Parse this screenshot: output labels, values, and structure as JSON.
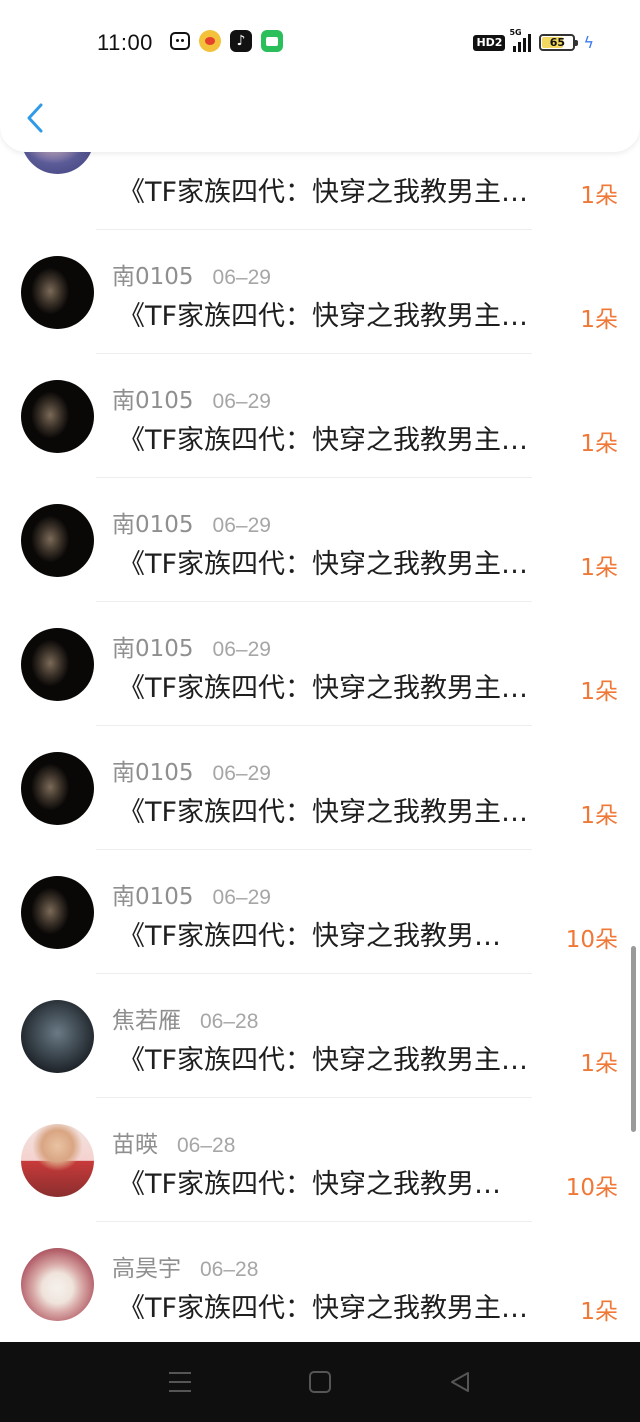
{
  "status_bar": {
    "time": "11:00",
    "network": "5G",
    "hd_label": "HD2",
    "battery_level": "65",
    "app_icons": [
      "bilibili-icon",
      "weibo-icon",
      "tiktok-icon",
      "message-icon"
    ]
  },
  "nav": {
    "back_icon": "chevron-left-icon"
  },
  "list": [
    {
      "name": "",
      "date": "",
      "title": "《TF家族四代：快穿之我教男主…",
      "flowers": "1朵",
      "avatar": "anime-girl"
    },
    {
      "name": "南0105",
      "date": "06–29",
      "title": "《TF家族四代：快穿之我教男主…",
      "flowers": "1朵",
      "avatar": "dark-portrait"
    },
    {
      "name": "南0105",
      "date": "06–29",
      "title": "《TF家族四代：快穿之我教男主…",
      "flowers": "1朵",
      "avatar": "dark-portrait"
    },
    {
      "name": "南0105",
      "date": "06–29",
      "title": "《TF家族四代：快穿之我教男主…",
      "flowers": "1朵",
      "avatar": "dark-portrait"
    },
    {
      "name": "南0105",
      "date": "06–29",
      "title": "《TF家族四代：快穿之我教男主…",
      "flowers": "1朵",
      "avatar": "dark-portrait"
    },
    {
      "name": "南0105",
      "date": "06–29",
      "title": "《TF家族四代：快穿之我教男主…",
      "flowers": "1朵",
      "avatar": "dark-portrait"
    },
    {
      "name": "南0105",
      "date": "06–29",
      "title": "《TF家族四代：快穿之我教男…",
      "flowers": "10朵",
      "avatar": "dark-portrait"
    },
    {
      "name": "焦若雁",
      "date": "06–28",
      "title": "《TF家族四代：快穿之我教男主…",
      "flowers": "1朵",
      "avatar": "game-soldier"
    },
    {
      "name": "苗暎",
      "date": "06–28",
      "title": "《TF家族四代：快穿之我教男…",
      "flowers": "10朵",
      "avatar": "boy-photo"
    },
    {
      "name": "高昊宇",
      "date": "06–28",
      "title": "《TF家族四代：快穿之我教男主…",
      "flowers": "1朵",
      "avatar": "photo-frame"
    }
  ],
  "system_nav": {
    "icons": [
      "menu-icon",
      "home-icon",
      "back-triangle-icon"
    ]
  }
}
